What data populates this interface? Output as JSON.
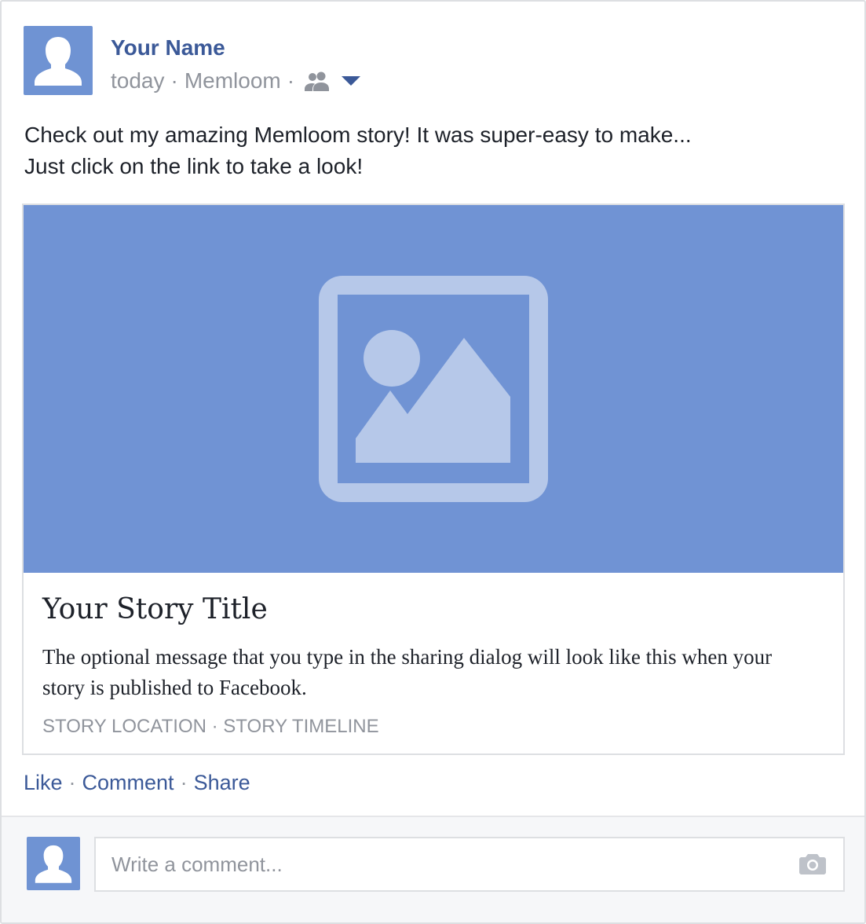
{
  "post": {
    "author_name": "Your Name",
    "timestamp": "today",
    "via": "Memloom",
    "separator": "·",
    "audience_icon": "friends-icon",
    "message_line1": "Check out my amazing Memloom story! It was super-easy to make...",
    "message_line2": "Just click on the link to take a look!"
  },
  "link_card": {
    "image_icon": "image-placeholder-icon",
    "title": "Your Story Title",
    "description": "The optional message that you type in the sharing dialog will look like this when your story is published to Facebook.",
    "meta_location": "STORY LOCATION",
    "meta_timeline": "STORY TIMELINE"
  },
  "actions": {
    "like": "Like",
    "comment": "Comment",
    "share": "Share"
  },
  "comment_box": {
    "placeholder": "Write a comment...",
    "icon": "camera-icon"
  },
  "colors": {
    "brand_blue": "#3b5998",
    "image_bg": "#7093d4",
    "image_fg": "#b6c8e9",
    "muted_text": "#90949c"
  }
}
